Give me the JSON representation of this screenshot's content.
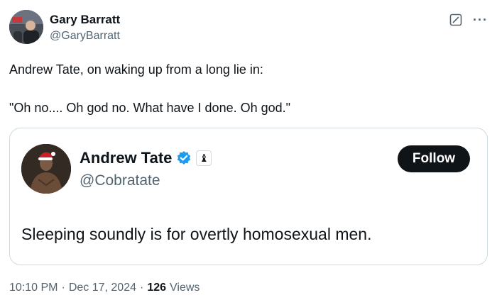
{
  "tweet": {
    "author_name": "Gary Barratt",
    "author_handle": "@GaryBarratt",
    "text_line1": "Andrew Tate, on waking up from a long lie in:",
    "text_line2": "\"Oh no.... Oh god no. What have I done. Oh god.\"",
    "icons": [
      "grok-icon",
      "more-icon"
    ],
    "more_label": "···"
  },
  "quote": {
    "author_name": "Andrew Tate",
    "author_handle": "@Cobratate",
    "verified": true,
    "affiliate_badge": "♝",
    "follow_label": "Follow",
    "text": "Sleeping soundly is for overtly homosexual men."
  },
  "meta": {
    "time": "10:10 PM",
    "separator1": "·",
    "date": "Dec 17, 2024",
    "separator2": "·",
    "views_count": "126",
    "views_label": "Views"
  },
  "colors": {
    "text_primary": "#0f1419",
    "text_secondary": "#536471",
    "border": "#cfd9de",
    "verified_blue": "#1d9bf0",
    "follow_bg": "#0f1419"
  }
}
